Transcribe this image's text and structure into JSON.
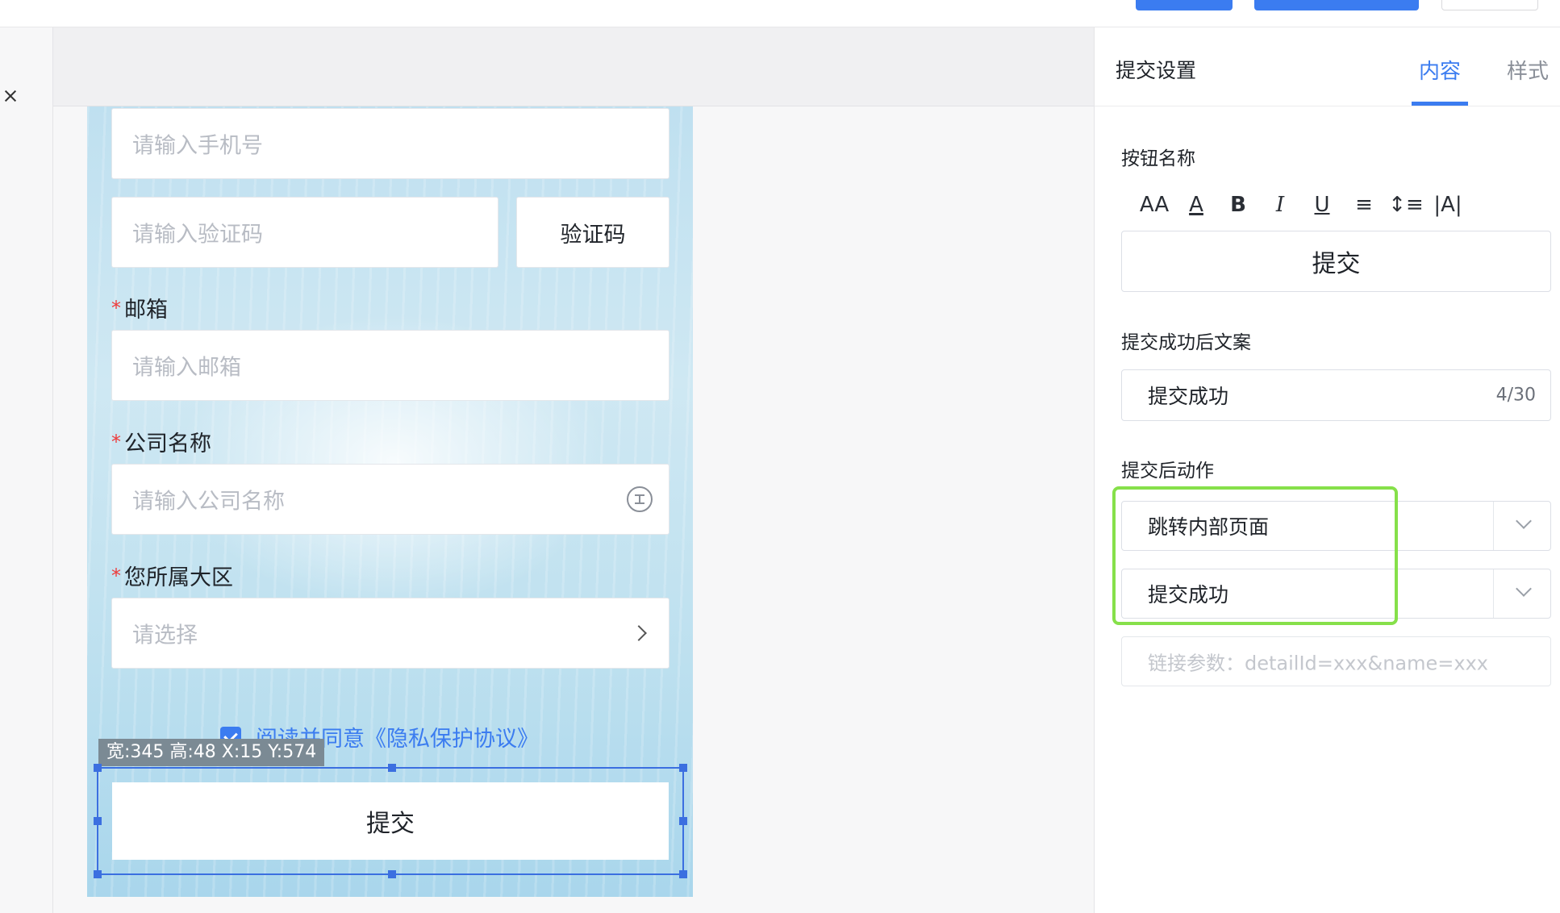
{
  "canvas": {
    "phone_field": {
      "placeholder": "请输入手机号"
    },
    "code_field": {
      "placeholder": "请输入验证码",
      "button_label": "验证码"
    },
    "email": {
      "label": "邮箱",
      "placeholder": "请输入邮箱"
    },
    "company": {
      "label": "公司名称",
      "placeholder": "请输入公司名称"
    },
    "region": {
      "label": "您所属大区",
      "placeholder": "请选择"
    },
    "required_mark": "*",
    "agreement": {
      "text": "阅读并同意《隐私保护协议》",
      "checked": true
    },
    "selection_badge": "宽:345 高:48 X:15 Y:574",
    "submit_label": "提交"
  },
  "panel": {
    "title": "提交设置",
    "tabs": [
      {
        "label": "内容",
        "active": true
      },
      {
        "label": "样式",
        "active": false
      }
    ],
    "button_name": {
      "label": "按钮名称",
      "toolbar": [
        "font-size-icon",
        "font-color-icon",
        "bold-icon",
        "italic-icon",
        "underline-icon",
        "align-center-icon",
        "line-height-icon",
        "letter-spacing-icon"
      ],
      "toolbar_glyphs": [
        "AA",
        "A",
        "B",
        "I",
        "U",
        "≡",
        "↕≡",
        "|A|"
      ],
      "value": "提交"
    },
    "success_text": {
      "label": "提交成功后文案",
      "value": "提交成功",
      "count": "4/30"
    },
    "after_action": {
      "label": "提交后动作",
      "select1": "跳转内部页面",
      "select2": "提交成功",
      "param_placeholder": "链接参数：detailId=xxx&name=xxx"
    }
  },
  "colors": {
    "accent": "#3b7cf0",
    "highlight": "#86e04a",
    "required": "#ee3b3b"
  }
}
